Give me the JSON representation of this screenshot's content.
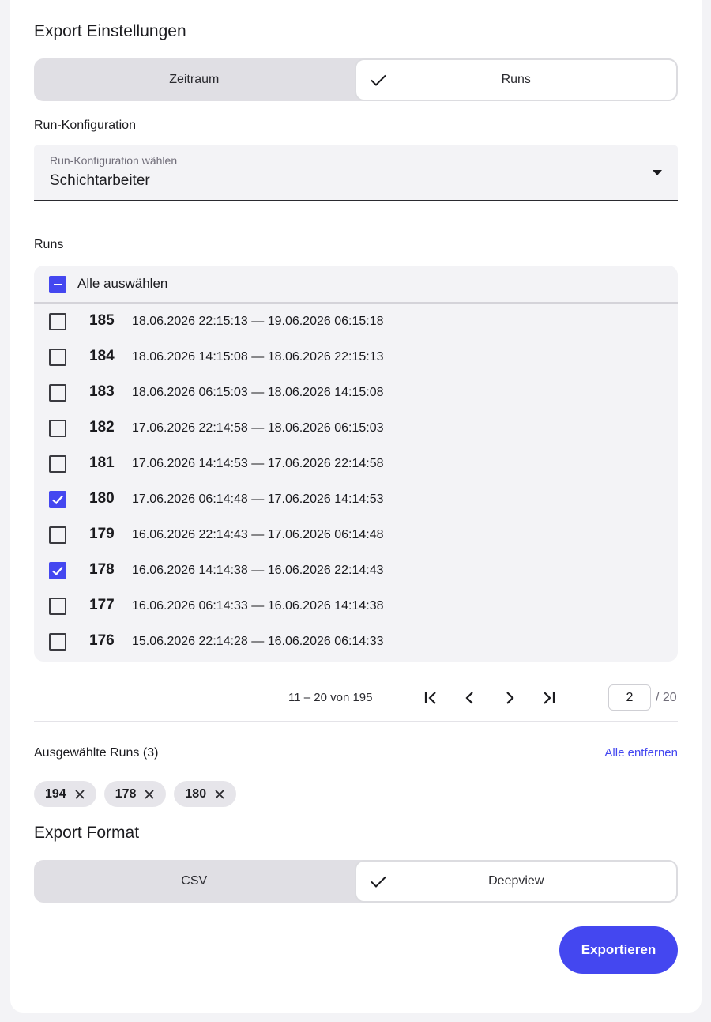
{
  "export_settings": {
    "title": "Export Einstellungen",
    "mode_options": [
      {
        "label": "Zeitraum",
        "active": false
      },
      {
        "label": "Runs",
        "active": true
      }
    ]
  },
  "run_config": {
    "label": "Run-Konfiguration",
    "select_label": "Run-Konfiguration wählen",
    "select_value": "Schichtarbeiter"
  },
  "runs": {
    "label": "Runs",
    "select_all_label": "Alle auswählen",
    "items": [
      {
        "id": "185",
        "range": "18.06.2026 22:15:13 — 19.06.2026 06:15:18",
        "checked": false
      },
      {
        "id": "184",
        "range": "18.06.2026 14:15:08 — 18.06.2026 22:15:13",
        "checked": false
      },
      {
        "id": "183",
        "range": "18.06.2026 06:15:03 — 18.06.2026 14:15:08",
        "checked": false
      },
      {
        "id": "182",
        "range": "17.06.2026 22:14:58 — 18.06.2026 06:15:03",
        "checked": false
      },
      {
        "id": "181",
        "range": "17.06.2026 14:14:53 — 17.06.2026 22:14:58",
        "checked": false
      },
      {
        "id": "180",
        "range": "17.06.2026 06:14:48 — 17.06.2026 14:14:53",
        "checked": true,
        "focused": true
      },
      {
        "id": "179",
        "range": "16.06.2026 22:14:43 — 17.06.2026 06:14:48",
        "checked": false
      },
      {
        "id": "178",
        "range": "16.06.2026 14:14:38 — 16.06.2026 22:14:43",
        "checked": true
      },
      {
        "id": "177",
        "range": "16.06.2026 06:14:33 — 16.06.2026 14:14:38",
        "checked": false
      },
      {
        "id": "176",
        "range": "15.06.2026 22:14:28 — 16.06.2026 06:14:33",
        "checked": false
      }
    ]
  },
  "pagination": {
    "info": "11 – 20 von 195",
    "current_page": "2",
    "total_pages": "/ 20"
  },
  "selected": {
    "title": "Ausgewählte Runs (3)",
    "remove_all_label": "Alle entfernen",
    "chips": [
      "194",
      "178",
      "180"
    ]
  },
  "export_format": {
    "title": "Export Format",
    "options": [
      {
        "label": "CSV",
        "active": false
      },
      {
        "label": "Deepview",
        "active": true
      }
    ]
  },
  "export_button": "Exportieren",
  "colors": {
    "accent": "#4447f0",
    "segment_bg": "#e0dfe4",
    "panel_bg": "#f3f3f6"
  }
}
